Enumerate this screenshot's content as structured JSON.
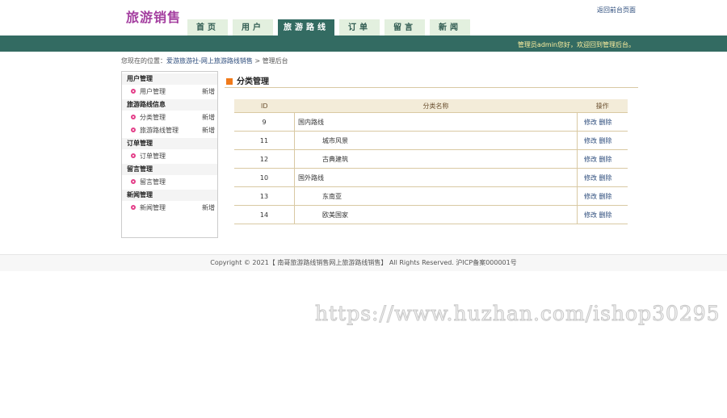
{
  "header": {
    "logo": "旅游销售",
    "front_link": "返回前台页面",
    "tabs": [
      {
        "label": "首页",
        "active": false
      },
      {
        "label": "用户",
        "active": false
      },
      {
        "label": "旅游路线",
        "active": true
      },
      {
        "label": "订单",
        "active": false
      },
      {
        "label": "留言",
        "active": false
      },
      {
        "label": "新闻",
        "active": false
      }
    ],
    "welcome": "管理员admin您好，欢迎回到管理后台。"
  },
  "breadcrumb": {
    "prefix": "您现在的位置：",
    "link": "爱游旅游社-网上旅游路线销售",
    "sep": " > ",
    "current": "管理后台"
  },
  "sidebar": {
    "groups": [
      {
        "title": "用户管理",
        "items": [
          {
            "label": "用户管理",
            "add": "新增"
          }
        ]
      },
      {
        "title": "旅游路线信息",
        "items": [
          {
            "label": "分类管理",
            "add": "新增"
          },
          {
            "label": "旅游路线管理",
            "add": "新增"
          }
        ]
      },
      {
        "title": "订单管理",
        "items": [
          {
            "label": "订单管理",
            "add": ""
          }
        ]
      },
      {
        "title": "留言管理",
        "items": [
          {
            "label": "留言管理",
            "add": ""
          }
        ]
      },
      {
        "title": "新闻管理",
        "items": [
          {
            "label": "新闻管理",
            "add": "新增"
          }
        ]
      }
    ]
  },
  "panel": {
    "title": "分类管理",
    "columns": {
      "id": "ID",
      "name": "分类名称",
      "ops": "操作"
    },
    "rows": [
      {
        "id": "9",
        "name": "国内路线",
        "child": false,
        "edit": "修改",
        "del": "删除"
      },
      {
        "id": "11",
        "name": "城市风景",
        "child": true,
        "edit": "修改",
        "del": "删除"
      },
      {
        "id": "12",
        "name": "古典建筑",
        "child": true,
        "edit": "修改",
        "del": "删除"
      },
      {
        "id": "10",
        "name": "国外路线",
        "child": false,
        "edit": "修改",
        "del": "删除"
      },
      {
        "id": "13",
        "name": "东南亚",
        "child": true,
        "edit": "修改",
        "del": "删除"
      },
      {
        "id": "14",
        "name": "欧美国家",
        "child": true,
        "edit": "修改",
        "del": "删除"
      }
    ]
  },
  "footer": {
    "text": "Copyright © 2021【 南哥旅游路线销售网上旅游路线销售】 All Rights Reserved. 沪ICP备案000001号"
  },
  "watermark": "https://www.huzhan.com/ishop30295",
  "colors": {
    "brand": "#a43fa0",
    "bar": "#336b62",
    "accent": "#f07a1a"
  }
}
